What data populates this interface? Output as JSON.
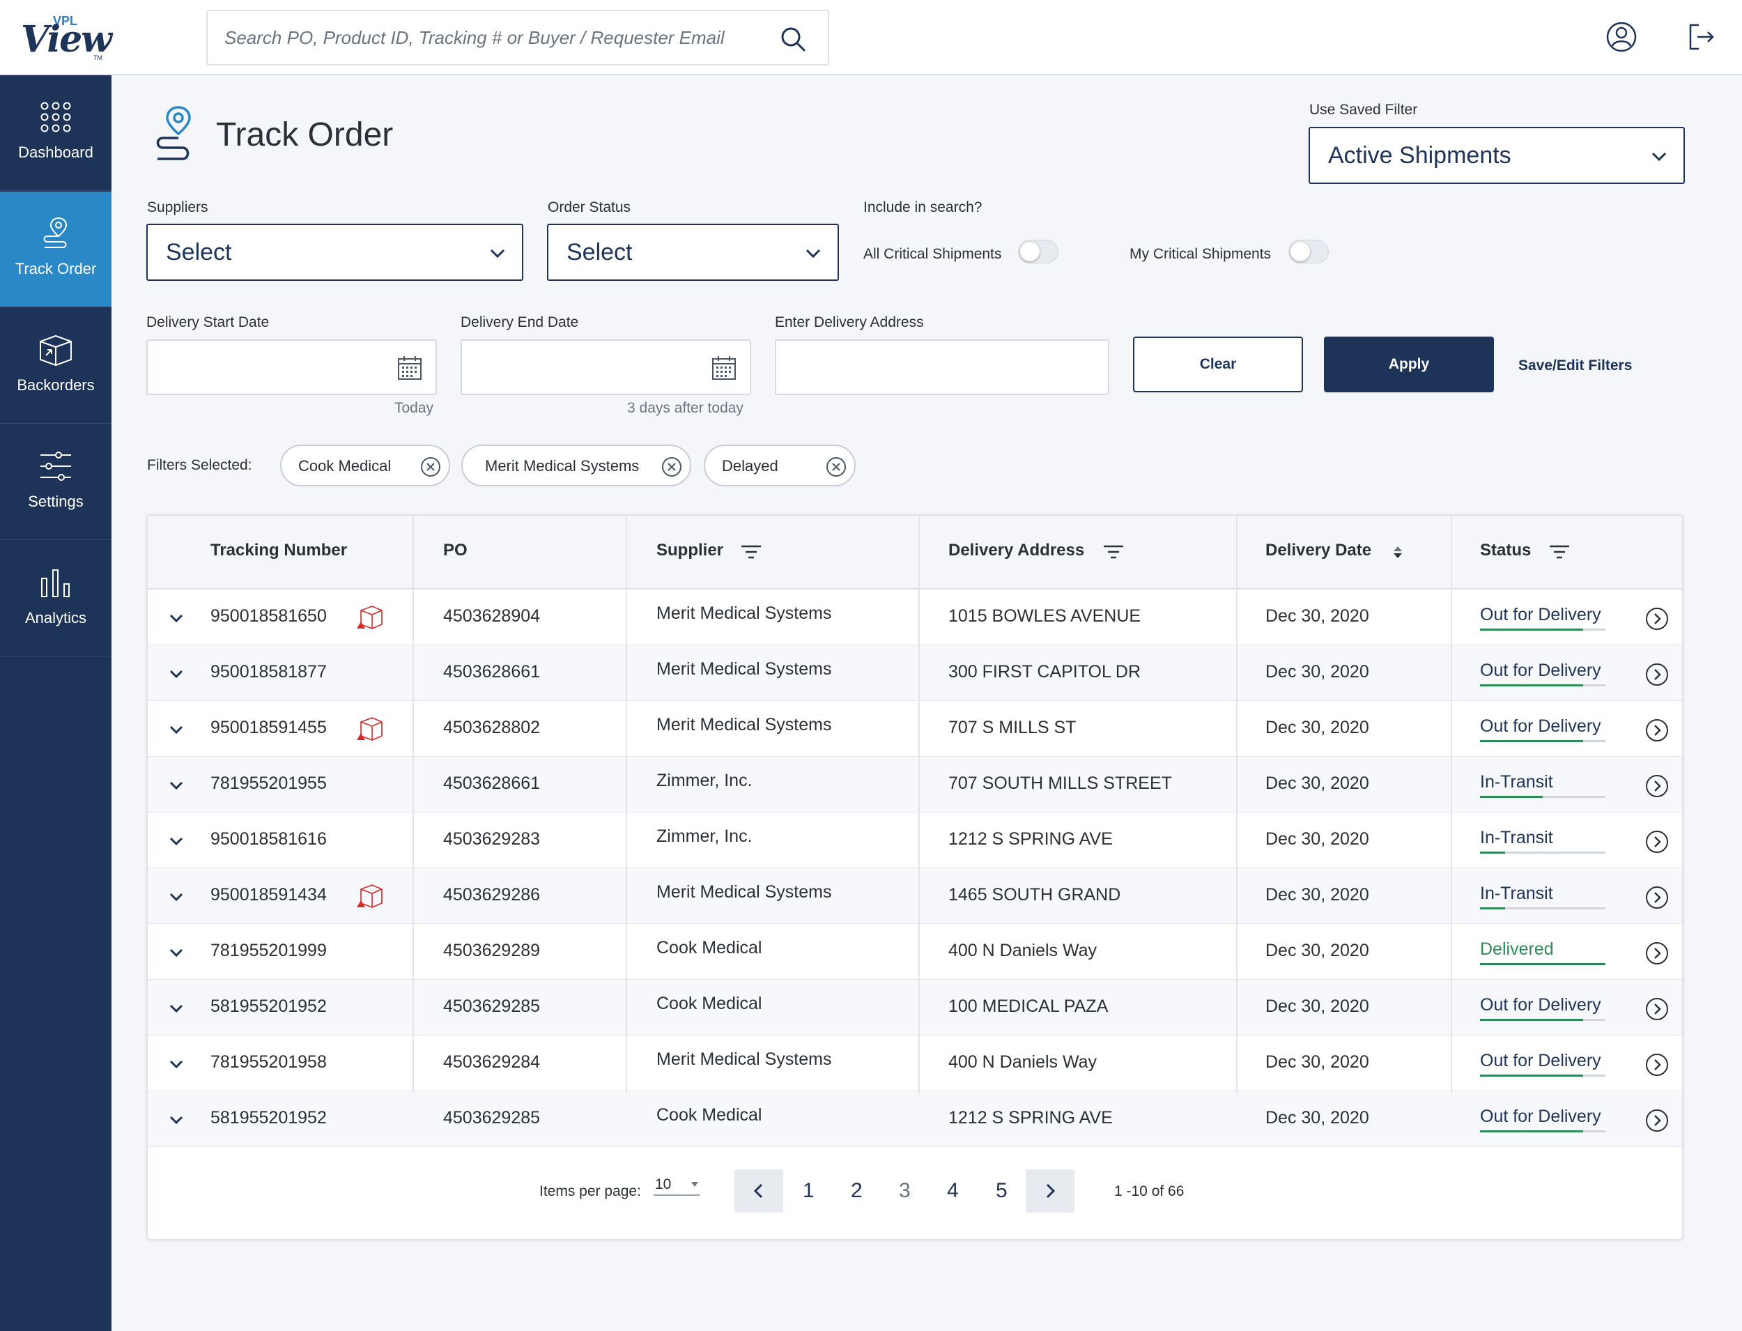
{
  "app": {
    "logo_prefix": "VPL",
    "logo_text": "View",
    "logo_tm": "TM"
  },
  "search": {
    "placeholder": "Search PO, Product ID, Tracking # or Buyer / Requester Email",
    "value": ""
  },
  "sidebar": {
    "items": [
      {
        "label": "Dashboard",
        "icon": "dots-grid-icon",
        "active": false
      },
      {
        "label": "Track Order",
        "icon": "location-route-icon",
        "active": true
      },
      {
        "label": "Backorders",
        "icon": "box-icon",
        "active": false
      },
      {
        "label": "Settings",
        "icon": "sliders-icon",
        "active": false
      },
      {
        "label": "Analytics",
        "icon": "bar-chart-icon",
        "active": false
      }
    ]
  },
  "page": {
    "title": "Track Order"
  },
  "saved_filter": {
    "label": "Use Saved Filter",
    "value": "Active Shipments"
  },
  "filters": {
    "suppliers_label": "Suppliers",
    "suppliers_value": "Select",
    "order_status_label": "Order Status",
    "order_status_value": "Select",
    "include_label": "Include in search?",
    "all_critical_label": "All Critical Shipments",
    "all_critical_on": false,
    "my_critical_label": "My Critical Shipments",
    "my_critical_on": false,
    "start_date_label": "Delivery Start Date",
    "start_date_hint": "Today",
    "end_date_label": "Delivery End Date",
    "end_date_hint": "3 days after today",
    "address_label": "Enter Delivery Address",
    "clear_label": "Clear",
    "apply_label": "Apply",
    "save_edit_label": "Save/Edit Filters",
    "selected_label": "Filters Selected:",
    "chips": [
      "Cook Medical",
      "Merit Medical Systems",
      "Delayed"
    ]
  },
  "table": {
    "headers": {
      "tracking": "Tracking Number",
      "po": "PO",
      "supplier": "Supplier",
      "address": "Delivery Address",
      "date": "Delivery Date",
      "status": "Status"
    },
    "rows": [
      {
        "tracking": "950018581650",
        "po": "4503628904",
        "supplier": "Merit Medical Systems",
        "address": "1015 BOWLES AVENUE",
        "date": "Dec 30, 2020",
        "status": "Out for Delivery",
        "progress": 0.82,
        "flag": true
      },
      {
        "tracking": "950018581877",
        "po": "4503628661",
        "supplier": "Merit Medical Systems",
        "address": "300 FIRST CAPITOL DR",
        "date": "Dec 30, 2020",
        "status": "Out for Delivery",
        "progress": 0.82,
        "flag": false
      },
      {
        "tracking": "950018591455",
        "po": "4503628802",
        "supplier": "Merit Medical Systems",
        "address": "707 S MILLS ST",
        "date": "Dec 30, 2020",
        "status": "Out for Delivery",
        "progress": 0.82,
        "flag": true
      },
      {
        "tracking": "781955201955",
        "po": "4503628661",
        "supplier": "Zimmer, Inc.",
        "address": "707 SOUTH MILLS STREET",
        "date": "Dec 30, 2020",
        "status": "In-Transit",
        "progress": 0.5,
        "flag": false
      },
      {
        "tracking": "950018581616",
        "po": "4503629283",
        "supplier": "Zimmer, Inc.",
        "address": "1212 S SPRING AVE",
        "date": "Dec 30, 2020",
        "status": "In-Transit",
        "progress": 0.2,
        "flag": false
      },
      {
        "tracking": "950018591434",
        "po": "4503629286",
        "supplier": "Merit Medical Systems",
        "address": "1465 SOUTH GRAND",
        "date": "Dec 30, 2020",
        "status": "In-Transit",
        "progress": 0.2,
        "flag": true
      },
      {
        "tracking": "781955201999",
        "po": "4503629289",
        "supplier": "Cook Medical",
        "address": "400 N Daniels Way",
        "date": "Dec 30, 2020",
        "status": "Delivered",
        "progress": 1.0,
        "flag": false
      },
      {
        "tracking": "581955201952",
        "po": "4503629285",
        "supplier": "Cook Medical",
        "address": "100 MEDICAL PAZA",
        "date": "Dec 30, 2020",
        "status": "Out for Delivery",
        "progress": 0.82,
        "flag": false
      },
      {
        "tracking": "781955201958",
        "po": "4503629284",
        "supplier": "Merit Medical Systems",
        "address": "400 N Daniels Way",
        "date": "Dec 30, 2020",
        "status": "Out for Delivery",
        "progress": 0.82,
        "flag": false
      },
      {
        "tracking": "581955201952",
        "po": "4503629285",
        "supplier": "Cook Medical",
        "address": "1212 S SPRING AVE",
        "date": "Dec 30, 2020",
        "status": "Out for Delivery",
        "progress": 0.82,
        "flag": false
      }
    ]
  },
  "pagination": {
    "items_per_page_label": "Items per page:",
    "items_per_page": "10",
    "pages": [
      "1",
      "2",
      "3",
      "4",
      "5"
    ],
    "current_page": "3",
    "range": "1 -10 of 66"
  },
  "colors": {
    "navy": "#1e3358",
    "active_nav": "#2a88c6",
    "status_green": "#2e8b57",
    "delivered_text": "#2e8b57",
    "alert_red": "#d42a2a"
  }
}
